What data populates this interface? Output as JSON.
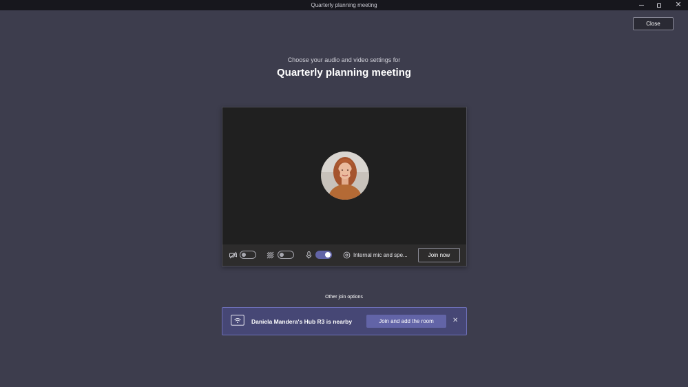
{
  "window": {
    "title": "Quarterly planning meeting",
    "minimize_icon": "minimize-icon",
    "maximize_icon": "maximize-icon",
    "close_icon": "close-icon",
    "close_glyph": "✕"
  },
  "header": {
    "close_label": "Close",
    "subtitle": "Choose your audio and video settings for",
    "title": "Quarterly planning meeting"
  },
  "preview": {
    "avatar_icon": "user-avatar",
    "camera_icon": "camera-off-icon",
    "camera_on": false,
    "background_icon": "background-effects-icon",
    "background_on": false,
    "mic_icon": "microphone-icon",
    "mic_on": true,
    "device_icon": "device-settings-icon",
    "device_label": "Internal mic and spe...",
    "join_label": "Join now"
  },
  "join_options": {
    "heading": "Other join options",
    "room_icon": "room-cast-icon",
    "room_text": "Daniela Mandera's Hub R3 is nearby",
    "add_room_label": "Join and add the room",
    "dismiss_glyph": "✕"
  },
  "colors": {
    "background": "#3d3d4d",
    "accent": "#6264a7",
    "card": "#464775"
  }
}
